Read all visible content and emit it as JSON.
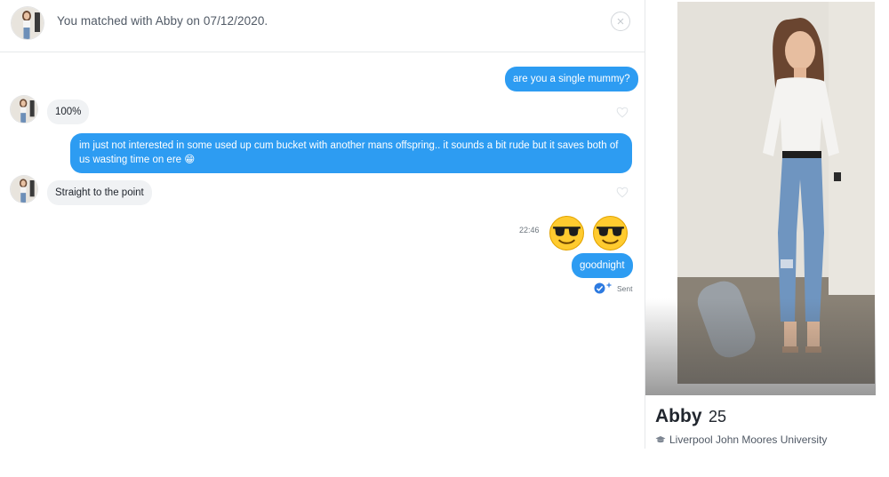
{
  "match_header": {
    "text": "You matched with Abby on 07/12/2020.",
    "close_icon": "close-icon"
  },
  "messages": [
    {
      "direction": "out",
      "text": "are you a single mummy?"
    },
    {
      "direction": "in",
      "text": "100%"
    },
    {
      "direction": "out",
      "text": "im just not interested in some used up cum bucket with another mans offspring.. it sounds a bit rude but it saves both of us wasting time on ere 😁"
    },
    {
      "direction": "in",
      "text": "Straight to the point"
    },
    {
      "direction": "out",
      "time": "22:46",
      "emojis": [
        "😎",
        "😎"
      ]
    },
    {
      "direction": "out",
      "text": "goodnight",
      "status": "Sent"
    }
  ],
  "profile": {
    "name": "Abby",
    "age": "25",
    "school": "Liverpool John Moores University",
    "school_icon": "graduation-cap-icon"
  },
  "colors": {
    "outgoing_bubble": "#2d9cf2",
    "incoming_bubble": "#f0f2f4",
    "divider": "#e6e8ea"
  }
}
